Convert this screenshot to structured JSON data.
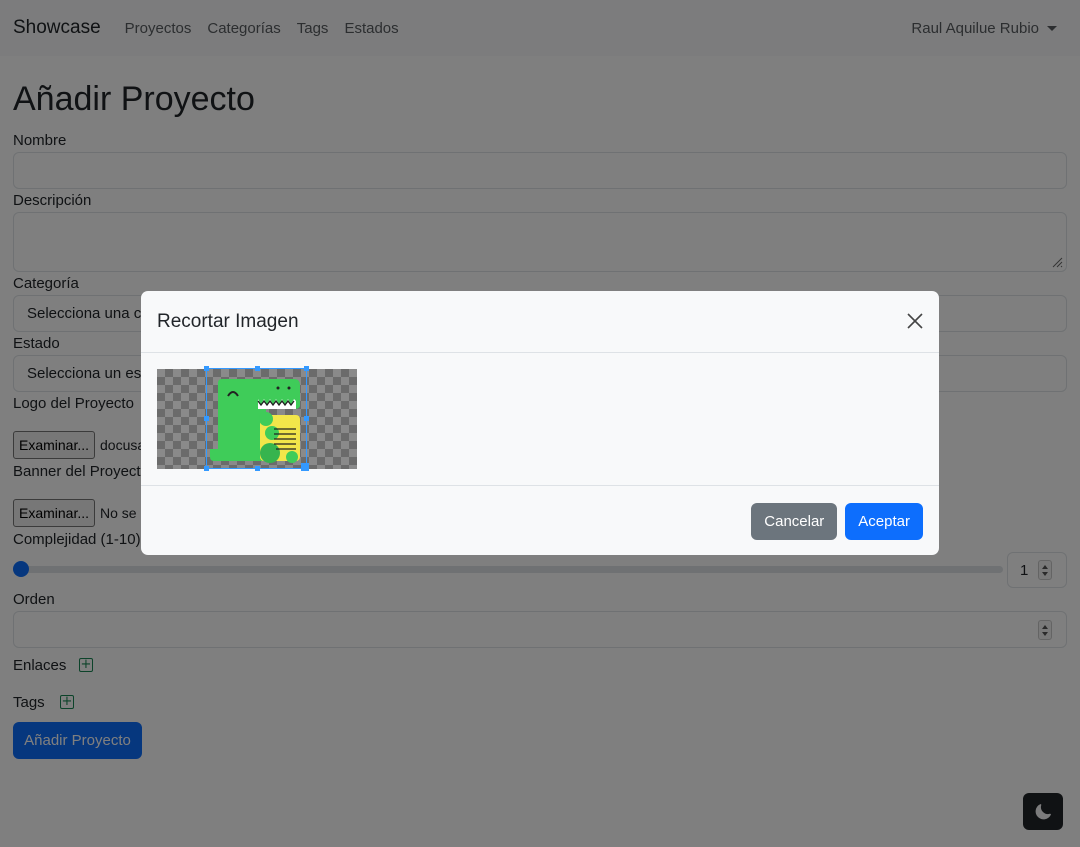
{
  "navbar": {
    "brand": "Showcase",
    "links": [
      "Proyectos",
      "Categorías",
      "Tags",
      "Estados"
    ],
    "user": "Raul Aquilue Rubio"
  },
  "form": {
    "title": "Añadir Proyecto",
    "nombre_label": "Nombre",
    "descripcion_label": "Descripción",
    "categoria_label": "Categoría",
    "categoria_value": "Selecciona una categoría",
    "estado_label": "Estado",
    "estado_value": "Selecciona un estado",
    "logo_label": "Logo del Proyecto",
    "logo_button": "Examinar...",
    "logo_file": "docusaurus.png",
    "banner_label": "Banner del Proyecto",
    "banner_button": "Examinar...",
    "banner_file": "No se ha seleccionado ningún archivo.",
    "complejidad_label": "Complejidad (1-10)",
    "complejidad_value": "1",
    "complejidad_fraction": 0,
    "orden_label": "Orden",
    "enlaces_label": "Enlaces",
    "tags_label": "Tags",
    "submit": "Añadir Proyecto"
  },
  "modal": {
    "title": "Recortar Imagen",
    "cancel": "Cancelar",
    "accept": "Aceptar"
  },
  "icons": {
    "close": "close-icon",
    "plus": "plus-square-icon",
    "moon": "moon-icon",
    "caret": "chevron-down-icon"
  },
  "colors": {
    "primary": "#0d6efd",
    "secondary": "#6c757d",
    "success": "#198754",
    "crop_accent": "#3399ff"
  }
}
